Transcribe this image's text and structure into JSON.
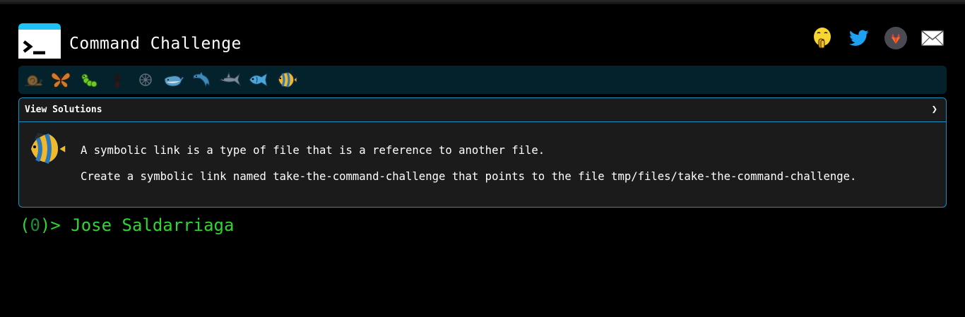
{
  "app": {
    "title": "Command Challenge",
    "logo_icon": "terminal-prompt-icon",
    "accent_color": "#1ec2f5"
  },
  "social_links": [
    {
      "name": "shushing-face-icon",
      "color": "#f7d631"
    },
    {
      "name": "twitter-icon",
      "color": "#1da1f2"
    },
    {
      "name": "gitlab-icon",
      "color": "#e2432a"
    },
    {
      "name": "email-icon",
      "color": "#ffffff"
    }
  ],
  "levels": [
    {
      "icon": "snail-icon",
      "completed": false
    },
    {
      "icon": "butterfly-icon",
      "completed": false
    },
    {
      "icon": "caterpillar-icon",
      "completed": false
    },
    {
      "icon": "ant-icon",
      "completed": false
    },
    {
      "icon": "wheel-icon",
      "completed": false
    },
    {
      "icon": "whale-icon",
      "completed": false
    },
    {
      "icon": "dolphin-icon",
      "completed": false
    },
    {
      "icon": "shark-icon",
      "completed": false
    },
    {
      "icon": "fish-icon",
      "completed": false
    },
    {
      "icon": "tropical-fish-icon",
      "current": true
    }
  ],
  "panel": {
    "view_solutions_label": "View Solutions",
    "chevron": "❯",
    "challenge_icon": "tropical-fish-icon",
    "description_line1": "A symbolic link is a type of file that is a reference to another file.",
    "description_line2": "Create a symbolic link named take-the-command-challenge that points to the file tmp/files/take-the-command-challenge."
  },
  "prompt": {
    "open": "(",
    "count": "0",
    "close": ")>",
    "user": "Jose Saldarriaga"
  }
}
